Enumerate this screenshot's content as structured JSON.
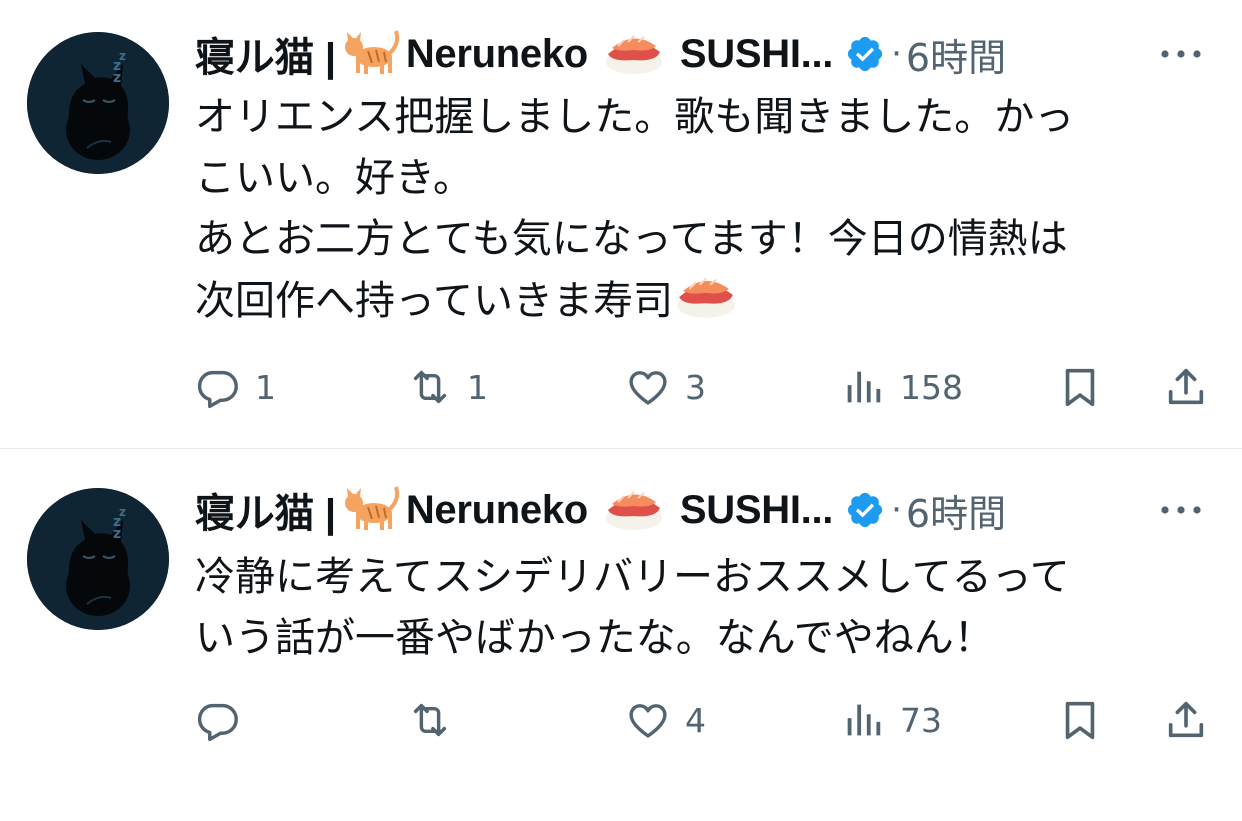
{
  "tweets": [
    {
      "author": {
        "name_prefix": "寝ル猫 |",
        "name_mid": "Neruneko",
        "name_suffix": "SUSHI...",
        "avatar_icon": "sleeping-black-cat-avatar",
        "verified_icon": "verified-badge-icon",
        "emojis": [
          "cat-emoji",
          "sushi-emoji"
        ]
      },
      "dot": "·",
      "time": "6時間",
      "body_lines": [
        "オリエンス把握しました。歌も聞きました。かっ",
        "こいい。好き。",
        "あとお二方とても気になってます！今日の情熱は",
        "次回作へ持っていきま寿司"
      ],
      "body_trailing_emoji": "sushi-emoji",
      "actions": {
        "replies": "1",
        "retweets": "1",
        "likes": "3",
        "views": "158"
      }
    },
    {
      "author": {
        "name_prefix": "寝ル猫 |",
        "name_mid": "Neruneko",
        "name_suffix": "SUSHI...",
        "avatar_icon": "sleeping-black-cat-avatar",
        "verified_icon": "verified-badge-icon",
        "emojis": [
          "cat-emoji",
          "sushi-emoji"
        ]
      },
      "dot": "·",
      "time": "6時間",
      "body_lines": [
        "冷静に考えてスシデリバリーおススメしてるって",
        "いう話が一番やばかったな。なんでやねん！"
      ],
      "actions": {
        "replies": "",
        "retweets": "",
        "likes": "4",
        "views": "73"
      }
    }
  ],
  "colors": {
    "text": "#0f1419",
    "secondary": "#536471",
    "verified": "#1d9bf0",
    "avatar_bg": "#0f2534",
    "divider": "#e6ebee"
  }
}
